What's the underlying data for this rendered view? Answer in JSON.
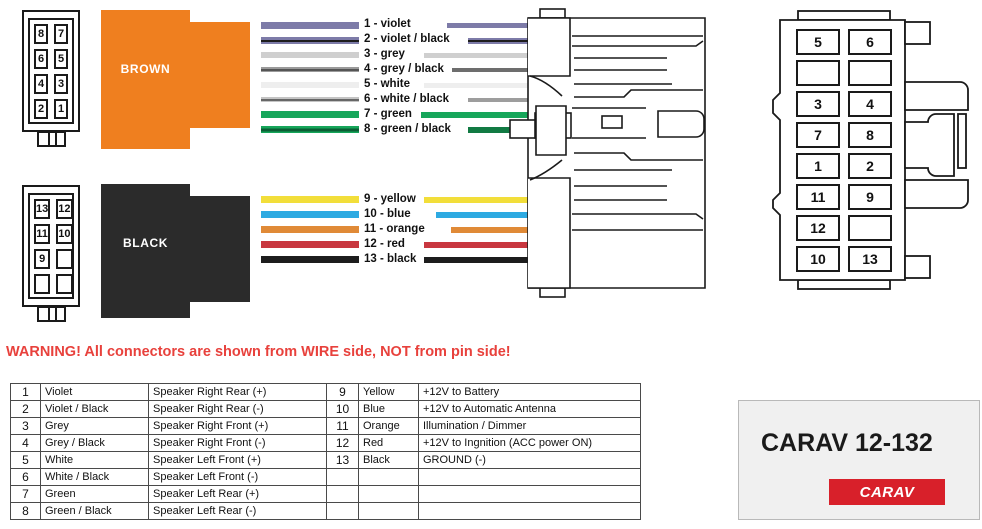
{
  "document": {
    "title": "CARAV 12-132 ISO wiring harness pinout diagram"
  },
  "warning": {
    "text": "WARNING! All connectors are shown from WIRE side, NOT from pin side!",
    "color": "#e8413c"
  },
  "housings": [
    {
      "name": "brown-housing",
      "label": "BROWN",
      "color": "#ef7f1f",
      "text_color": "#ffffff"
    },
    {
      "name": "black-housing",
      "label": "BLACK",
      "color": "#2b2b2b",
      "text_color": "#ffffff"
    }
  ],
  "left_connector_top": {
    "name": "brown-iso-connector",
    "pins": [
      "8",
      "7",
      "6",
      "5",
      "4",
      "3",
      "2",
      "1"
    ]
  },
  "left_connector_bottom": {
    "name": "black-iso-connector",
    "pins": [
      "13",
      "12",
      "11",
      "10",
      "9",
      "",
      "",
      ""
    ]
  },
  "right_connector": {
    "name": "oem-head-unit-connector",
    "pins": [
      "5",
      "6",
      "",
      "",
      "3",
      "4",
      "7",
      "8",
      "1",
      "2",
      "11",
      "9",
      "12",
      "",
      "10",
      "13"
    ]
  },
  "wires_top": [
    {
      "n": "1",
      "label": "1 - violet",
      "color": "#7d7ba8",
      "stripe": false
    },
    {
      "n": "2",
      "label": "2 - violet / black",
      "color": "#7d7ba8",
      "stripe": true
    },
    {
      "n": "3",
      "label": "3 - grey",
      "color": "#cfcfcf",
      "stripe": false
    },
    {
      "n": "4",
      "label": "4 - grey / black",
      "color": "#cfcfcf",
      "stripe": true
    },
    {
      "n": "5",
      "label": "5 - white",
      "color": "#eeeeee",
      "stripe": false
    },
    {
      "n": "6",
      "label": "6 - white / black",
      "color": "#eeeeee",
      "stripe": true
    },
    {
      "n": "7",
      "label": "7 - green",
      "color": "#16a65a",
      "stripe": false
    },
    {
      "n": "8",
      "label": "8 - green / black",
      "color": "#16a65a",
      "stripe": true
    }
  ],
  "wires_bottom": [
    {
      "n": "9",
      "label": "9 - yellow",
      "color": "#f2de3a",
      "stripe": false
    },
    {
      "n": "10",
      "label": "10 - blue",
      "color": "#2eaae2",
      "stripe": false
    },
    {
      "n": "11",
      "label": "11 - orange",
      "color": "#e08a37",
      "stripe": false
    },
    {
      "n": "12",
      "label": "12 - red",
      "color": "#c8373f",
      "stripe": false
    },
    {
      "n": "13",
      "label": "13 - black",
      "color": "#1d1d1d",
      "stripe": false
    }
  ],
  "table_left": {
    "name": "pinout-table-left",
    "rows": [
      {
        "pin": "1",
        "color": "Violet",
        "function": "Speaker Right Rear (+)"
      },
      {
        "pin": "2",
        "color": "Violet / Black",
        "function": "Speaker Right Rear (-)"
      },
      {
        "pin": "3",
        "color": "Grey",
        "function": "Speaker Right Front (+)"
      },
      {
        "pin": "4",
        "color": "Grey / Black",
        "function": "Speaker Right Front (-)"
      },
      {
        "pin": "5",
        "color": "White",
        "function": "Speaker Left Front (+)"
      },
      {
        "pin": "6",
        "color": "White / Black",
        "function": "Speaker Left Front (-)"
      },
      {
        "pin": "7",
        "color": "Green",
        "function": "Speaker Left Rear (+)"
      },
      {
        "pin": "8",
        "color": "Green / Black",
        "function": "Speaker Left Rear (-)"
      }
    ]
  },
  "table_right": {
    "name": "pinout-table-right",
    "rows": [
      {
        "pin": "9",
        "color": "Yellow",
        "function": "+12V to Battery"
      },
      {
        "pin": "10",
        "color": "Blue",
        "function": "+12V to Automatic Antenna"
      },
      {
        "pin": "11",
        "color": "Orange",
        "function": "Illumination / Dimmer"
      },
      {
        "pin": "12",
        "color": "Red",
        "function": "+12V to Ingnition (ACC power ON)"
      },
      {
        "pin": "13",
        "color": "Black",
        "function": "GROUND (-)"
      },
      {
        "pin": "",
        "color": "",
        "function": ""
      },
      {
        "pin": "",
        "color": "",
        "function": ""
      },
      {
        "pin": "",
        "color": "",
        "function": ""
      }
    ]
  },
  "product": {
    "name": "carav-product-badge",
    "model": "CARAV 12-132",
    "brand": "CARAV",
    "brand_color": "#d8202a",
    "box_bg": "#f0f0f0"
  }
}
